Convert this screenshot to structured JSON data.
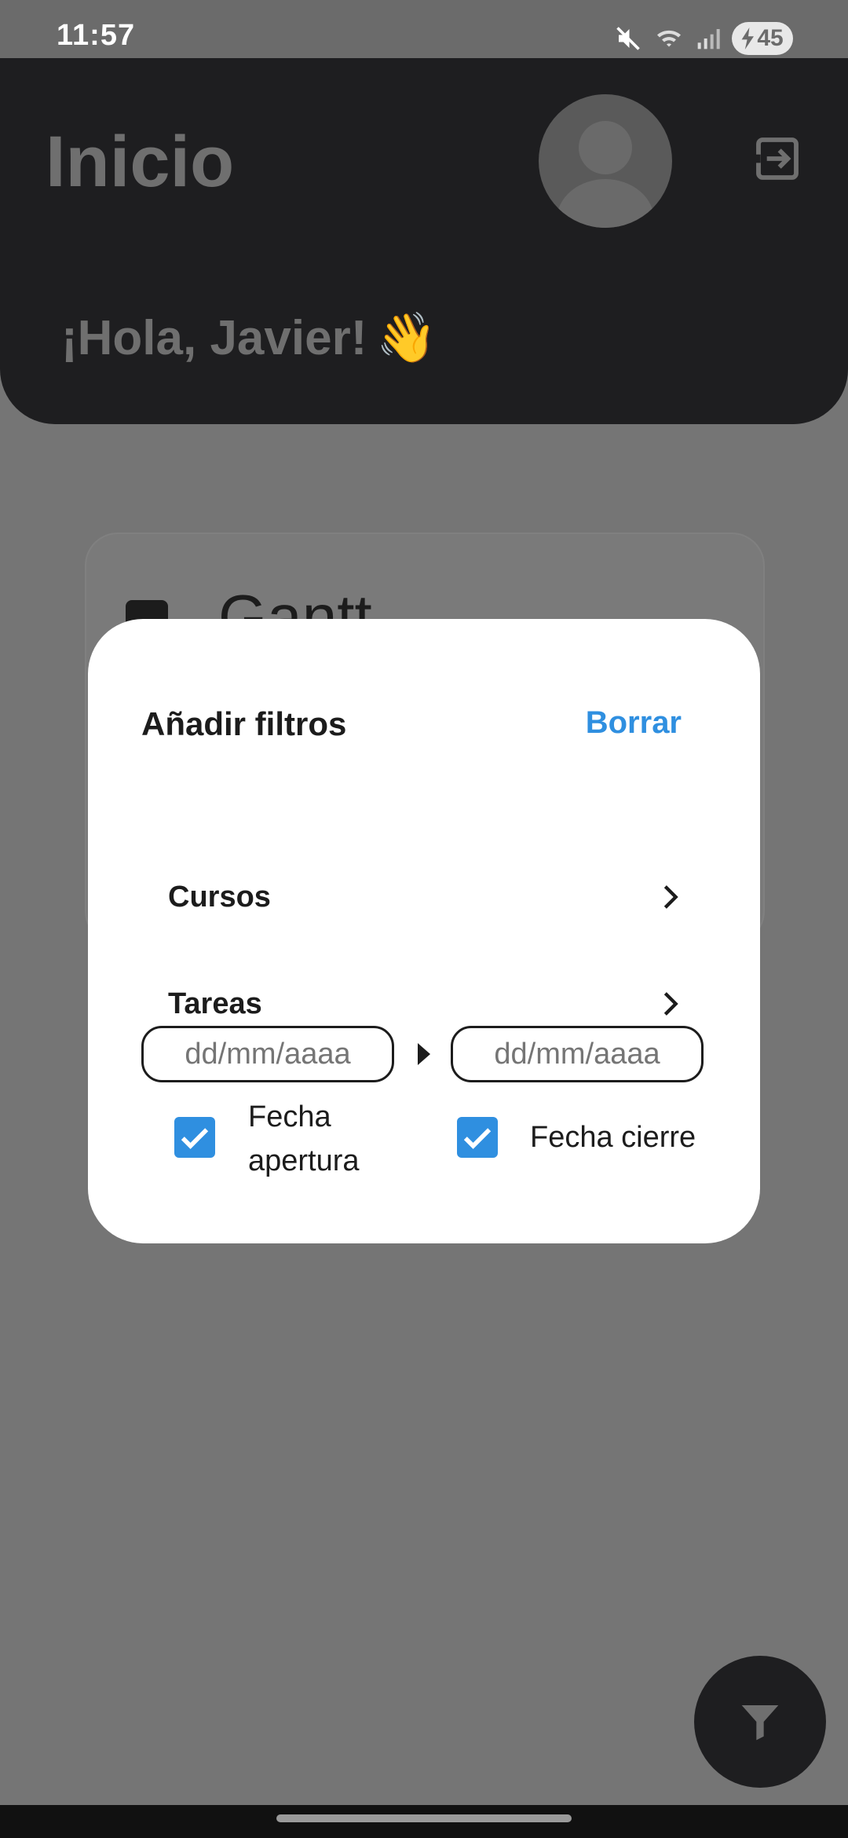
{
  "status_bar": {
    "time": "11:57",
    "battery": "45",
    "icons": [
      "mute-icon",
      "wifi-icon",
      "signal-icon",
      "battery-charging-icon"
    ]
  },
  "header": {
    "title": "Inicio",
    "greeting": "¡Hola, Javier!",
    "greeting_emoji": "👋",
    "avatar_icon": "person-icon",
    "logout_icon": "logout-icon"
  },
  "background_card": {
    "title": "Gantt"
  },
  "dialog": {
    "title": "Añadir filtros",
    "clear_label": "Borrar",
    "filters": [
      {
        "label": "Cursos"
      },
      {
        "label": "Tareas"
      }
    ],
    "date_start_placeholder": "dd/mm/aaaa",
    "date_end_placeholder": "dd/mm/aaaa",
    "check_open_label": "Fecha apertura",
    "check_close_label": "Fecha cierre",
    "check_open_checked": true,
    "check_close_checked": true
  },
  "fab": {
    "icon": "filter-icon"
  },
  "colors": {
    "accent": "#2f8fe0",
    "header_bg": "#1e1e20",
    "scrim": "#757575"
  }
}
